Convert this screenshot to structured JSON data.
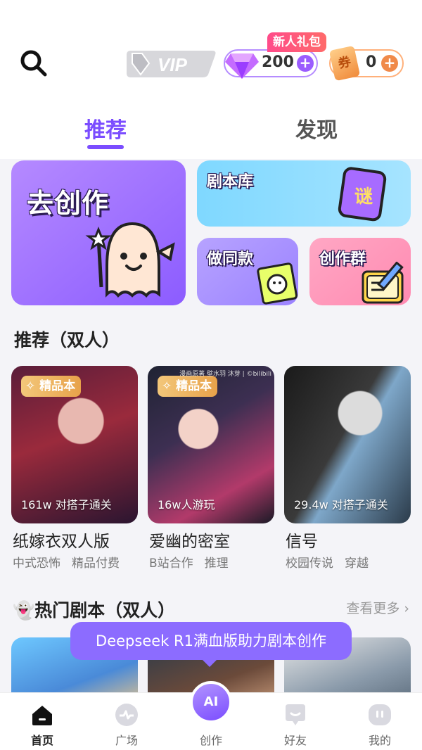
{
  "header": {
    "vip_label": "VIP",
    "gift_tag": "新人礼包",
    "gem_count": "200",
    "ticket_glyph": "券",
    "ticket_count": "0",
    "plus_glyph": "+"
  },
  "tabs": [
    {
      "label": "推荐",
      "active": true
    },
    {
      "label": "发现",
      "active": false
    }
  ],
  "feature_cards": {
    "create": "去创作",
    "library": "剧本库",
    "library_badge": "谜",
    "same_style": "做同款",
    "group": "创作群"
  },
  "recommend_section": {
    "title": "推荐（双人）",
    "stories": [
      {
        "name": "纸嫁衣双人版",
        "badge": "精品本",
        "players": "161w 对搭子通关",
        "tags": [
          "中式恐怖",
          "精品付费"
        ]
      },
      {
        "name": "爱幽的密室",
        "badge": "精品本",
        "players": "16w人游玩",
        "tags": [
          "B站合作",
          "推理"
        ],
        "cover_credit": "漫画原著 壁水羽 沐芽 | ©bilibili"
      },
      {
        "name": "信号",
        "badge": "",
        "players": "29.4w 对搭子通关",
        "tags": [
          "校园传说",
          "穿越"
        ]
      }
    ]
  },
  "hot_section": {
    "title": "热门剧本（双人）",
    "emoji": "👻",
    "see_more": "查看更多 ›"
  },
  "tooltip": "Deepseek R1满血版助力剧本创作",
  "bottom_nav": {
    "items": [
      {
        "label": "首页",
        "icon": "home-icon",
        "active": true
      },
      {
        "label": "广场",
        "icon": "plaza-icon",
        "active": false
      },
      {
        "label": "创作",
        "icon": "ai-create-icon",
        "active": false
      },
      {
        "label": "好友",
        "icon": "friends-icon",
        "active": false
      },
      {
        "label": "我的",
        "icon": "profile-icon",
        "active": false
      }
    ],
    "create_glyph": "AI"
  },
  "colors": {
    "accent": "#7b4dff",
    "gem": "#b58cff",
    "ticket": "#f08a4a"
  }
}
